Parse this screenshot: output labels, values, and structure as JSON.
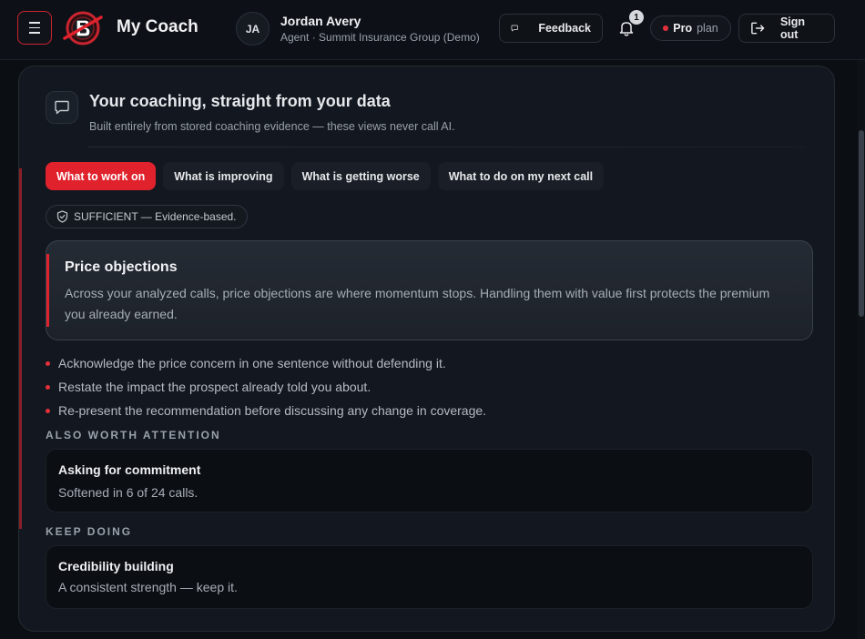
{
  "header": {
    "app_title": "My Coach",
    "user": {
      "initials": "JA",
      "name": "Jordan Avery",
      "role": "Agent · Summit Insurance Group (Demo)"
    },
    "feedback_label": "Feedback",
    "notification_count": "1",
    "plan": {
      "tier": "Pro",
      "word": "plan"
    },
    "signout_label": "Sign out"
  },
  "coaching": {
    "title": "Your coaching, straight from your data",
    "subtitle": "Built entirely from stored coaching evidence — these views never call AI.",
    "tabs": [
      {
        "label": "What to work on",
        "active": true
      },
      {
        "label": "What is improving",
        "active": false
      },
      {
        "label": "What is getting worse",
        "active": false
      },
      {
        "label": "What to do on my next call",
        "active": false
      }
    ],
    "status": "SUFFICIENT — Evidence-based.",
    "focus": {
      "title": "Price objections",
      "body": "Across your analyzed calls, price objections are where momentum stops. Handling them with value first protects the premium you already earned."
    },
    "steps": [
      "Acknowledge the price concern in one sentence without defending it.",
      "Restate the impact the prospect already told you about.",
      "Re-present the recommendation before discussing any change in coverage."
    ],
    "also_worth_attention": {
      "label": "ALSO WORTH ATTENTION",
      "items": [
        {
          "title": "Asking for commitment",
          "detail": "Softened in 6 of 24 calls."
        }
      ]
    },
    "keep_doing": {
      "label": "KEEP DOING",
      "items": [
        {
          "title": "Credibility building",
          "detail": "A consistent strength — keep it."
        }
      ]
    }
  },
  "colors": {
    "accent": "#e0222d",
    "background": "#0b0e13",
    "card": "#121720"
  },
  "icons": {
    "menu": "hamburger-icon",
    "logo": "brand-logo",
    "feedback": "chat-bubble-icon",
    "notifications": "bell-icon",
    "signout": "sign-out-icon",
    "status": "shield-check-icon"
  }
}
